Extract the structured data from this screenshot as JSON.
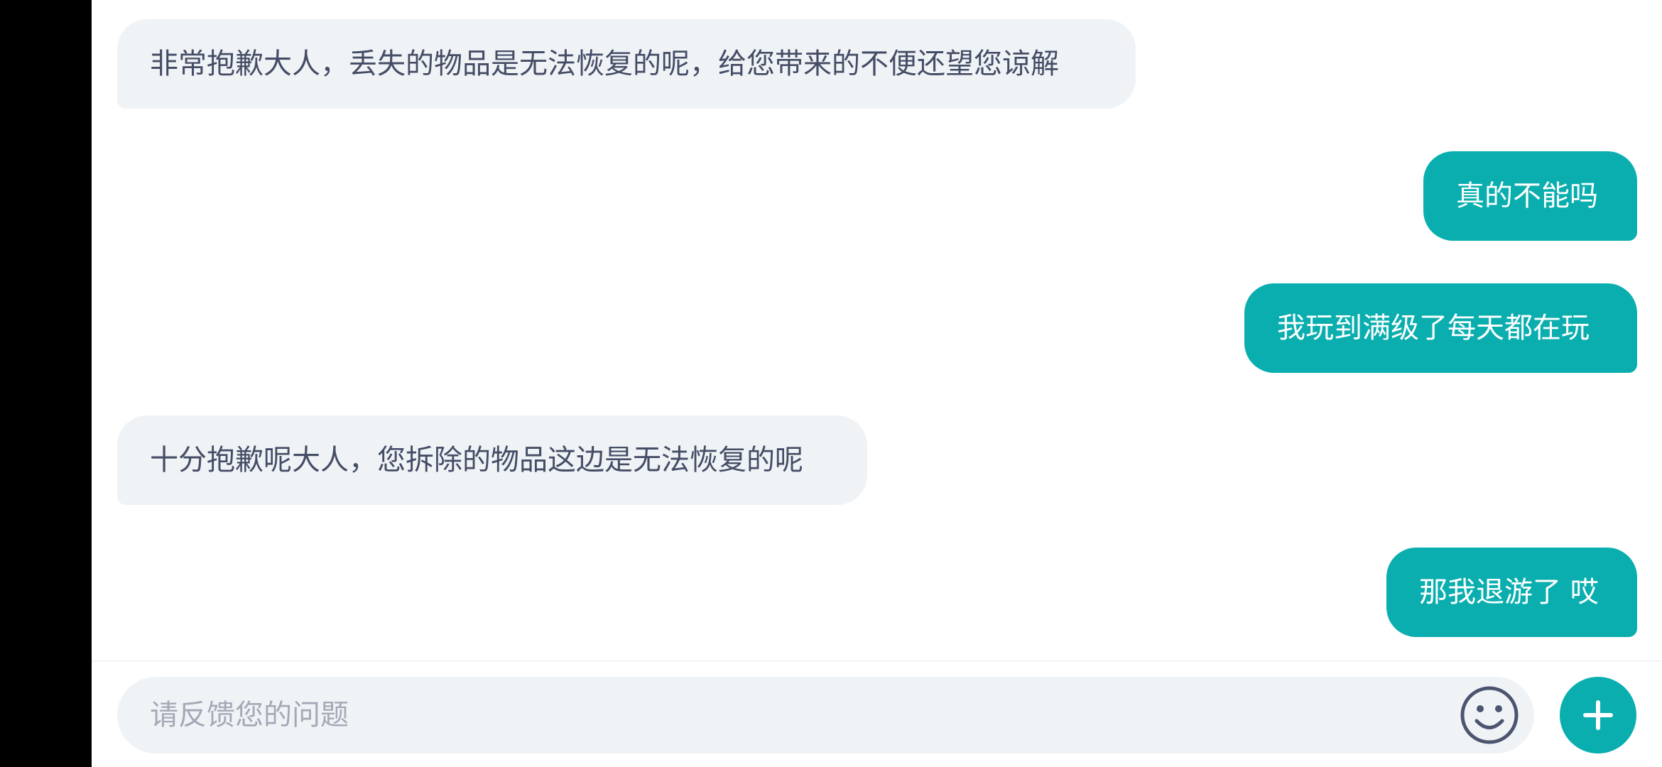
{
  "messages": [
    {
      "role": "agent",
      "text": "非常抱歉大人，丢失的物品是无法恢复的呢，给您带来的不便还望您谅解"
    },
    {
      "role": "user",
      "text": "真的不能吗"
    },
    {
      "role": "user",
      "text": "我玩到满级了每天都在玩"
    },
    {
      "role": "agent",
      "text": "十分抱歉呢大人，您拆除的物品这边是无法恢复的呢"
    },
    {
      "role": "user",
      "text": "那我退游了 哎"
    }
  ],
  "input": {
    "placeholder": "请反馈您的问题",
    "value": ""
  },
  "icons": {
    "emoji": "smiley-face-icon",
    "add": "plus-icon"
  },
  "colors": {
    "accent": "#0aaeaf",
    "agent_bubble": "#f0f3f6",
    "agent_text": "#454d66",
    "placeholder": "#a3a9b6"
  }
}
